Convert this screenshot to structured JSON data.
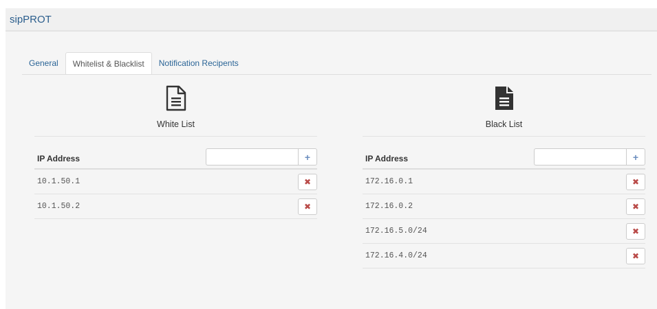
{
  "app": {
    "title": "sipPROT"
  },
  "tabs": [
    {
      "label": "General",
      "active": false
    },
    {
      "label": "Whitelist & Blacklist",
      "active": true
    },
    {
      "label": "Notification Recipents",
      "active": false
    }
  ],
  "whitelist": {
    "heading": "White List",
    "icon": "document-outline-icon",
    "column_header": "IP Address",
    "input_value": "",
    "add_label": "+",
    "delete_label": "✖",
    "entries": [
      "10.1.50.1",
      "10.1.50.2"
    ]
  },
  "blacklist": {
    "heading": "Black List",
    "icon": "document-filled-icon",
    "column_header": "IP Address",
    "input_value": "",
    "add_label": "+",
    "delete_label": "✖",
    "entries": [
      "172.16.0.1",
      "172.16.0.2",
      "172.16.5.0/24",
      "172.16.4.0/24"
    ]
  },
  "colors": {
    "link": "#2a6496",
    "delete": "#b94a48",
    "add": "#6c8ebf"
  }
}
